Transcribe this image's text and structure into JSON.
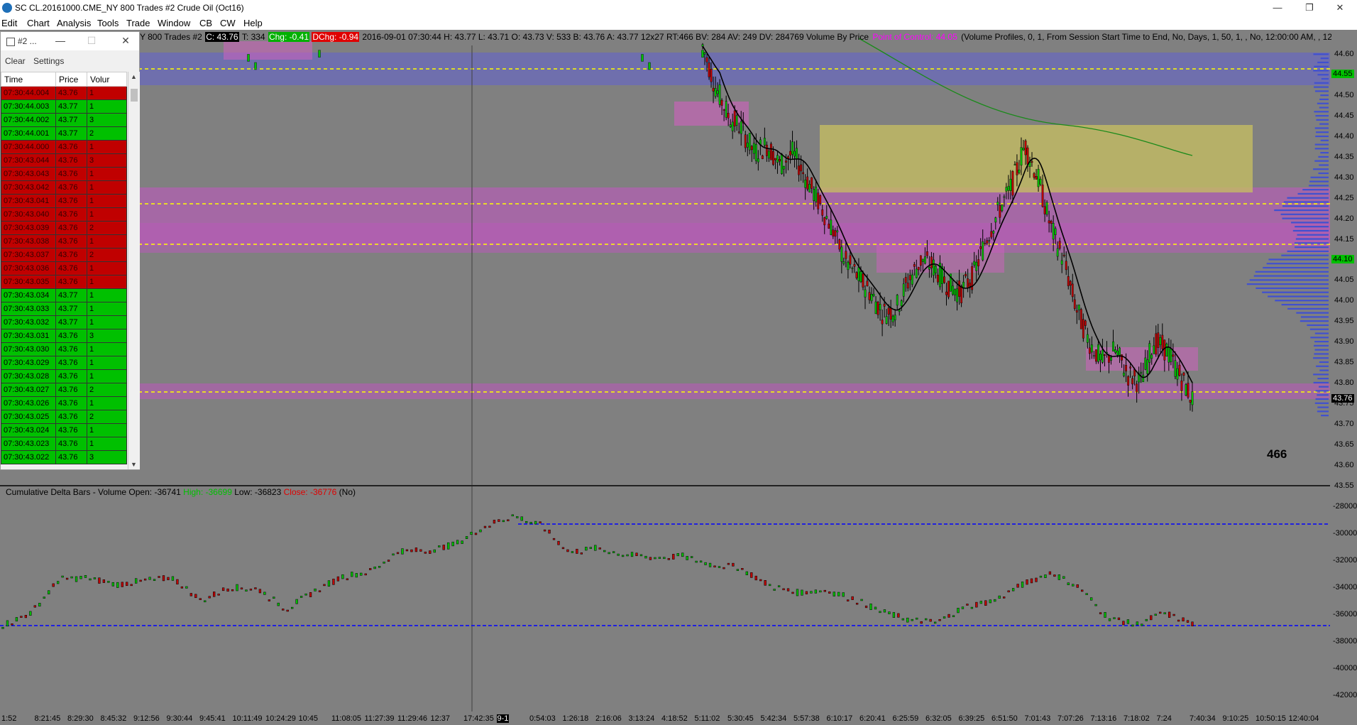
{
  "window": {
    "title": "SC CL.20161000.CME_NY  800 Trades  #2  Crude Oil (Oct16)",
    "minimize": "—",
    "restore": "❐",
    "close": "✕"
  },
  "menu": [
    "Edit",
    "Chart",
    "Analysis",
    "Tools",
    "Trade",
    "Window",
    "CB",
    "CW",
    "Help"
  ],
  "chart_header": {
    "prefix": "Y  800 Trades  #2",
    "close_badge": "C: 43.76",
    "trades": "T: 334",
    "change_badge": "Chg: -0.41",
    "dchange_badge": "DChg: -0.94",
    "bar_info": "2016-09-01 07:30:44 H: 43.77 L: 43.71 O: 43.73 V: 533 B: 43.76 A: 43.77 12x27 RT:466 BV: 284 AV: 249 DV: 284769 Volume By Price",
    "poc_label": "Point of Control: 44.05",
    "study_desc": "(Volume Profiles, 0, 1, From Session Start Time to End, No, Days, 1, 50, 1, , No, 12:00:00 AM, , 12:00:00 AM, No, Peri"
  },
  "time_sales": {
    "title": "#2 ...",
    "clear": "Clear",
    "settings": "Settings",
    "columns": [
      "Time",
      "Price",
      "Volur"
    ],
    "rows": [
      [
        "07:30:44.004",
        "43.76",
        "1",
        "dn"
      ],
      [
        "07:30:44.003",
        "43.77",
        "1",
        "up"
      ],
      [
        "07:30:44.002",
        "43.77",
        "3",
        "up"
      ],
      [
        "07:30:44.001",
        "43.77",
        "2",
        "up"
      ],
      [
        "07:30:44.000",
        "43.76",
        "1",
        "dn"
      ],
      [
        "07:30:43.044",
        "43.76",
        "3",
        "dn"
      ],
      [
        "07:30:43.043",
        "43.76",
        "1",
        "dn"
      ],
      [
        "07:30:43.042",
        "43.76",
        "1",
        "dn"
      ],
      [
        "07:30:43.041",
        "43.76",
        "1",
        "dn"
      ],
      [
        "07:30:43.040",
        "43.76",
        "1",
        "dn"
      ],
      [
        "07:30:43.039",
        "43.76",
        "2",
        "dn"
      ],
      [
        "07:30:43.038",
        "43.76",
        "1",
        "dn"
      ],
      [
        "07:30:43.037",
        "43.76",
        "2",
        "dn"
      ],
      [
        "07:30:43.036",
        "43.76",
        "1",
        "dn"
      ],
      [
        "07:30:43.035",
        "43.76",
        "1",
        "dn"
      ],
      [
        "07:30:43.034",
        "43.77",
        "1",
        "up"
      ],
      [
        "07:30:43.033",
        "43.77",
        "1",
        "up"
      ],
      [
        "07:30:43.032",
        "43.77",
        "1",
        "up"
      ],
      [
        "07:30:43.031",
        "43.76",
        "3",
        "up"
      ],
      [
        "07:30:43.030",
        "43.76",
        "1",
        "up"
      ],
      [
        "07:30:43.029",
        "43.76",
        "1",
        "up"
      ],
      [
        "07:30:43.028",
        "43.76",
        "1",
        "up"
      ],
      [
        "07:30:43.027",
        "43.76",
        "2",
        "up"
      ],
      [
        "07:30:43.026",
        "43.76",
        "1",
        "up"
      ],
      [
        "07:30:43.025",
        "43.76",
        "2",
        "up"
      ],
      [
        "07:30:43.024",
        "43.76",
        "1",
        "up"
      ],
      [
        "07:30:43.023",
        "43.76",
        "1",
        "up"
      ],
      [
        "07:30:43.022",
        "43.76",
        "3",
        "up"
      ]
    ]
  },
  "price_axis": [
    "44.60",
    "44.55",
    "44.50",
    "44.45",
    "44.40",
    "44.35",
    "44.30",
    "44.25",
    "44.20",
    "44.15",
    "44.10",
    "44.05",
    "44.00",
    "43.95",
    "43.90",
    "43.85",
    "43.80",
    "43.75",
    "43.70",
    "43.65",
    "43.60",
    "43.55"
  ],
  "price_markers": {
    "top": "44.55",
    "mid": "44.10",
    "last": "43.76"
  },
  "bar_count": "466",
  "delta_study": {
    "label": "Cumulative Delta Bars - Volume",
    "open": "Open: -36741",
    "high": "High: -36699",
    "low": "Low: -36823",
    "close": "Close: -36776",
    "flag": "(No)",
    "axis": [
      "-28000",
      "-30000",
      "-32000",
      "-34000",
      "-36000",
      "-38000",
      "-40000",
      "-42000"
    ]
  },
  "time_axis": [
    "1:52",
    "8:21:45",
    "8:29:30",
    "8:45:32",
    "9:12:56",
    "9:30:44",
    "9:45:41",
    "10:11:49",
    "10:24:29",
    "10:45",
    "11:08:05",
    "11:27:39",
    "11:29:46",
    "12:37",
    "17:42:35",
    "9-1",
    "0:54:03",
    "1:26:18",
    "2:16:06",
    "3:13:24",
    "4:18:52",
    "5:11:02",
    "5:30:45",
    "5:42:34",
    "5:57:38",
    "6:10:17",
    "6:20:41",
    "6:25:59",
    "6:32:05",
    "6:39:25",
    "6:51:50",
    "7:01:43",
    "7:07:26",
    "7:13:16",
    "7:18:02",
    "7:24",
    "7:40:34",
    "9:10:25",
    "10:50:15",
    "12:40:04"
  ],
  "chart_data": {
    "type": "candlestick",
    "symbol": "CL Crude Oil (Oct16)",
    "close_path": [
      44.62,
      44.52,
      44.45,
      44.42,
      44.36,
      44.38,
      44.33,
      44.36,
      44.3,
      44.24,
      44.18,
      44.1,
      44.06,
      44.02,
      43.97,
      43.98,
      44.05,
      44.1,
      44.08,
      44.04,
      44.02,
      44.06,
      44.15,
      44.22,
      44.28,
      44.38,
      44.3,
      44.18,
      44.1,
      43.98,
      43.9,
      43.85,
      43.88,
      43.82,
      43.8,
      43.9,
      43.88,
      43.82,
      43.76
    ],
    "price_range": [
      43.525,
      44.625
    ],
    "delta_close_path": [
      -36800,
      -35900,
      -33400,
      -33300,
      -33800,
      -33500,
      -33300,
      -35000,
      -34000,
      -34100,
      -35600,
      -34300,
      -33200,
      -32800,
      -31300,
      -31300,
      -30800,
      -29500,
      -28700,
      -29400,
      -31400,
      -31100,
      -31600,
      -31800,
      -31700,
      -32300,
      -32500,
      -33800,
      -34400,
      -34200,
      -34800,
      -35800,
      -36400,
      -36600,
      -35400,
      -35000,
      -33800,
      -32900,
      -34000,
      -36200,
      -36800,
      -35900,
      -36700
    ],
    "delta_range": [
      -43200,
      -27000
    ]
  },
  "colors": {
    "up": "#00c000",
    "down": "#c00000",
    "poc": "#ff00ff",
    "value_area": "#c8c060",
    "hvn": "#c060c0",
    "profile": "#4050d0"
  }
}
